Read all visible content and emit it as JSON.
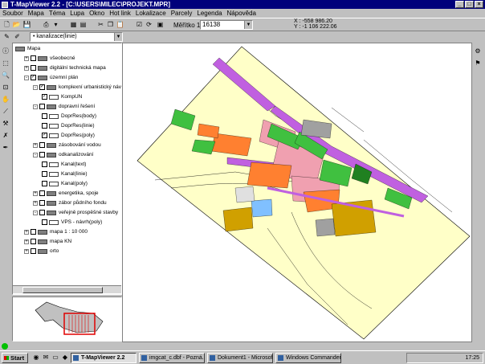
{
  "window": {
    "title": "T-MapViewer 2.2 - [C:\\USERS\\MILEC\\PROJEKT.MPR]"
  },
  "menu": [
    "Soubor",
    "Mapa",
    "Téma",
    "Lupa",
    "Okno",
    "Hot link",
    "Lokalizace",
    "Parcely",
    "Legenda",
    "Nápověda"
  ],
  "toolbar": {
    "scale_label": "Měřítko 1 :",
    "scale_value": "16138",
    "coord_x": "X : -558 986.20",
    "coord_y": "Y : -1 106 222.06"
  },
  "layer_select": {
    "value": "kanalizace(linie)"
  },
  "tree": [
    {
      "label": "Mapa",
      "level": 0,
      "type": "root"
    },
    {
      "label": "všeobecné",
      "level": 1,
      "pm": "+",
      "cb": false,
      "type": "folder"
    },
    {
      "label": "digitální technická mapa",
      "level": 1,
      "pm": "+",
      "cb": false,
      "type": "folder"
    },
    {
      "label": "územní plán",
      "level": 1,
      "pm": "-",
      "cb": true,
      "type": "folder"
    },
    {
      "label": "komplexní urbanistický náv",
      "level": 2,
      "pm": "-",
      "cb": true,
      "type": "folder"
    },
    {
      "label": "KompUN",
      "level": 3,
      "cb": true,
      "type": "theme"
    },
    {
      "label": "dopravní řešení",
      "level": 2,
      "pm": "-",
      "cb": false,
      "type": "folder"
    },
    {
      "label": "DoprRes(body)",
      "level": 3,
      "cb": false,
      "type": "theme"
    },
    {
      "label": "DoprRes(linie)",
      "level": 3,
      "cb": false,
      "type": "theme"
    },
    {
      "label": "DoprRes(poly)",
      "level": 3,
      "cb": true,
      "type": "theme"
    },
    {
      "label": "zásobování vodou",
      "level": 2,
      "pm": "+",
      "cb": false,
      "type": "folder"
    },
    {
      "label": "odkanalizování",
      "level": 2,
      "pm": "-",
      "cb": false,
      "type": "folder"
    },
    {
      "label": "Kanal(text)",
      "level": 3,
      "cb": false,
      "type": "theme"
    },
    {
      "label": "Kanal(linie)",
      "level": 3,
      "cb": false,
      "type": "theme"
    },
    {
      "label": "Kanal(poly)",
      "level": 3,
      "cb": false,
      "type": "theme"
    },
    {
      "label": "energetika, spoje",
      "level": 2,
      "pm": "+",
      "cb": false,
      "type": "folder"
    },
    {
      "label": "zábor půdního fondu",
      "level": 2,
      "pm": "+",
      "cb": false,
      "type": "folder"
    },
    {
      "label": "veřejně prospěšné stavby",
      "level": 2,
      "pm": "-",
      "cb": false,
      "type": "folder"
    },
    {
      "label": "VPS - návrh(poly)",
      "level": 3,
      "cb": false,
      "type": "theme"
    },
    {
      "label": "mapa 1 : 10 000",
      "level": 1,
      "pm": "+",
      "cb": false,
      "type": "folder"
    },
    {
      "label": "mapa KN",
      "level": 1,
      "pm": "+",
      "cb": false,
      "type": "folder"
    },
    {
      "label": "orto",
      "level": 1,
      "pm": "+",
      "cb": false,
      "type": "folder"
    }
  ],
  "taskbar": {
    "start": "Start",
    "tasks": [
      "T-MapViewer 2.2",
      "imgcat_c.dbf - Pozná...",
      "Dokument1 - Microsof...",
      "Windows Commander..."
    ],
    "clock": "17:25"
  },
  "colors": {
    "titlebar": "#00007b",
    "map_bg": "#ffffc8",
    "residential": "#f0a0b0",
    "industrial": "#ff8030",
    "green": "#40c040",
    "road": "#c060e0",
    "agri": "#d0a000",
    "gray": "#a0a0a0"
  }
}
